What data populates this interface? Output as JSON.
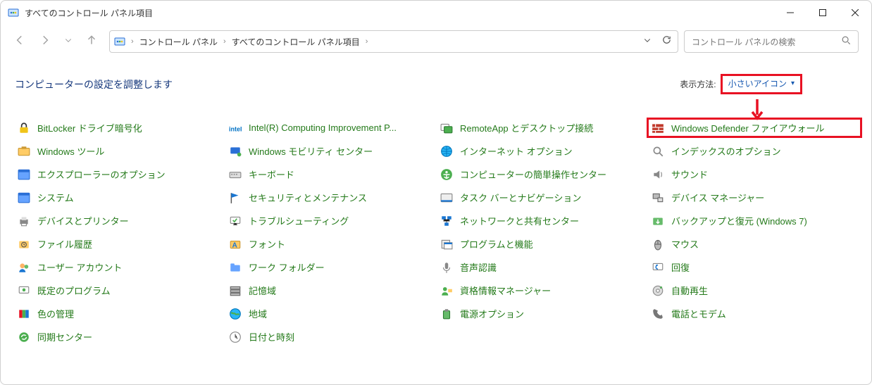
{
  "title": "すべてのコントロール パネル項目",
  "breadcrumbs": [
    "コントロール パネル",
    "すべてのコントロール パネル項目"
  ],
  "search_placeholder": "コントロール パネルの検索",
  "heading": "コンピューターの設定を調整します",
  "viewby_label": "表示方法:",
  "viewby_value": "小さいアイコン",
  "rows": [
    [
      {
        "icon": "bitlocker",
        "label": "BitLocker ドライブ暗号化"
      },
      {
        "icon": "intel",
        "label": "Intel(R) Computing Improvement P..."
      },
      {
        "icon": "remoteapp",
        "label": "RemoteApp とデスクトップ接続"
      },
      {
        "icon": "firewall",
        "label": "Windows Defender ファイアウォール",
        "hl": true
      }
    ],
    [
      {
        "icon": "tools",
        "label": "Windows ツール"
      },
      {
        "icon": "mobility",
        "label": "Windows モビリティ センター"
      },
      {
        "icon": "internet",
        "label": "インターネット オプション"
      },
      {
        "icon": "index",
        "label": "インデックスのオプション"
      }
    ],
    [
      {
        "icon": "explorer",
        "label": "エクスプローラーのオプション"
      },
      {
        "icon": "keyboard",
        "label": "キーボード"
      },
      {
        "icon": "ease",
        "label": "コンピューターの簡単操作センター"
      },
      {
        "icon": "sound",
        "label": "サウンド"
      }
    ],
    [
      {
        "icon": "system",
        "label": "システム"
      },
      {
        "icon": "security",
        "label": "セキュリティとメンテナンス"
      },
      {
        "icon": "taskbar",
        "label": "タスク バーとナビゲーション"
      },
      {
        "icon": "devmgr",
        "label": "デバイス マネージャー"
      }
    ],
    [
      {
        "icon": "printers",
        "label": "デバイスとプリンター"
      },
      {
        "icon": "trouble",
        "label": "トラブルシューティング"
      },
      {
        "icon": "network",
        "label": "ネットワークと共有センター"
      },
      {
        "icon": "backup",
        "label": "バックアップと復元 (Windows 7)"
      }
    ],
    [
      {
        "icon": "filehist",
        "label": "ファイル履歴"
      },
      {
        "icon": "fonts",
        "label": "フォント"
      },
      {
        "icon": "programs",
        "label": "プログラムと機能"
      },
      {
        "icon": "mouse",
        "label": "マウス"
      }
    ],
    [
      {
        "icon": "users",
        "label": "ユーザー アカウント"
      },
      {
        "icon": "workfolder",
        "label": "ワーク フォルダー"
      },
      {
        "icon": "speech",
        "label": "音声認識"
      },
      {
        "icon": "recovery",
        "label": "回復"
      }
    ],
    [
      {
        "icon": "default",
        "label": "既定のプログラム"
      },
      {
        "icon": "storage",
        "label": "記憶域"
      },
      {
        "icon": "cred",
        "label": "資格情報マネージャー"
      },
      {
        "icon": "autoplay",
        "label": "自動再生"
      }
    ],
    [
      {
        "icon": "color",
        "label": "色の管理"
      },
      {
        "icon": "region",
        "label": "地域"
      },
      {
        "icon": "power",
        "label": "電源オプション"
      },
      {
        "icon": "phone",
        "label": "電話とモデム"
      }
    ],
    [
      {
        "icon": "sync",
        "label": "同期センター"
      },
      {
        "icon": "datetime",
        "label": "日付と時刻"
      }
    ]
  ]
}
